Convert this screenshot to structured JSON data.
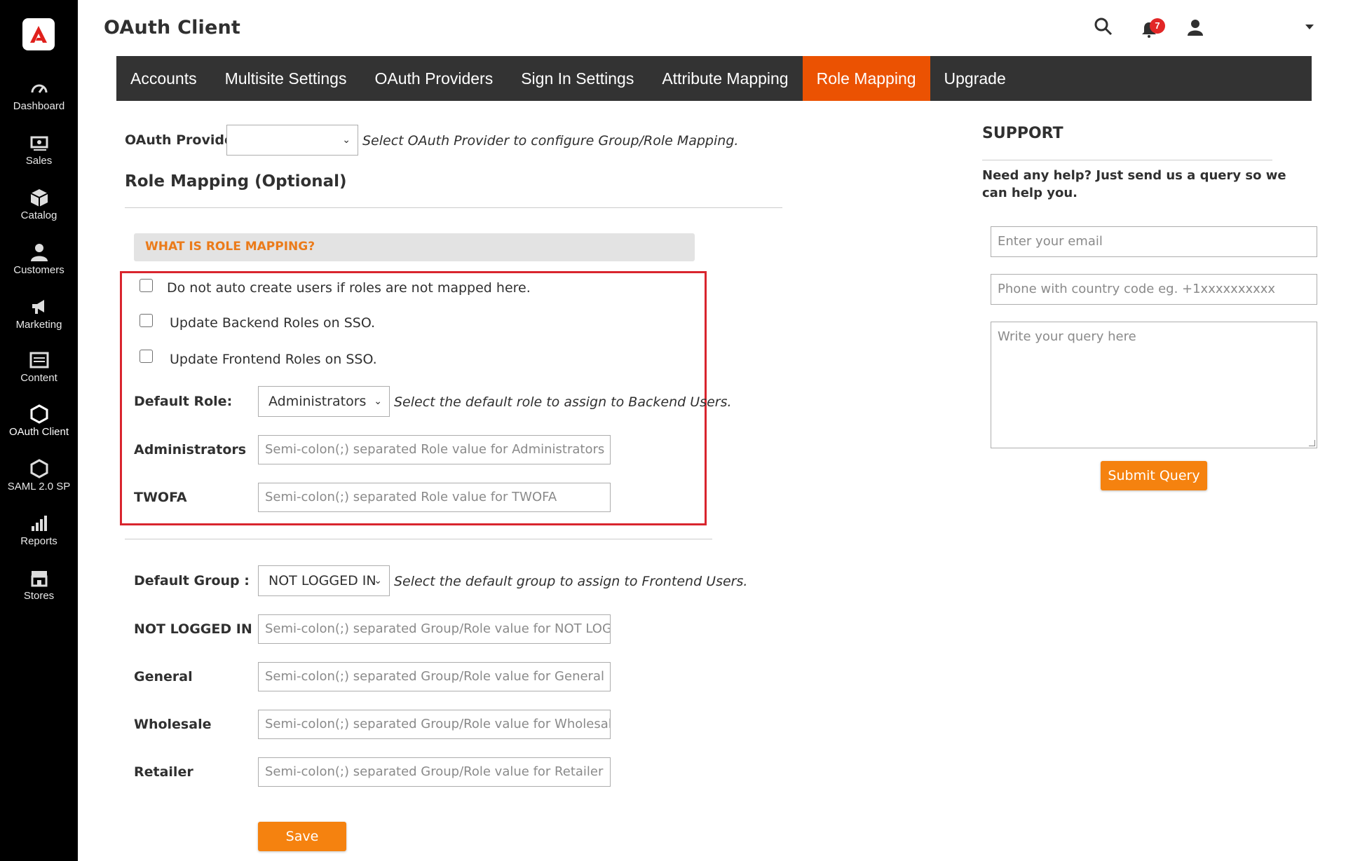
{
  "sidebar": {
    "logo": "adobe-logo",
    "items": [
      {
        "label": "Dashboard",
        "icon": "dashboard-icon"
      },
      {
        "label": "Sales",
        "icon": "sales-icon"
      },
      {
        "label": "Catalog",
        "icon": "catalog-icon"
      },
      {
        "label": "Customers",
        "icon": "customers-icon"
      },
      {
        "label": "Marketing",
        "icon": "marketing-icon"
      },
      {
        "label": "Content",
        "icon": "content-icon"
      },
      {
        "label": "OAuth Client",
        "icon": "hexagon-icon"
      },
      {
        "label": "SAML 2.0 SP",
        "icon": "hexagon-icon"
      },
      {
        "label": "Reports",
        "icon": "reports-icon"
      },
      {
        "label": "Stores",
        "icon": "stores-icon"
      }
    ]
  },
  "header": {
    "title": "OAuth Client",
    "notification_count": "7"
  },
  "tabs": [
    {
      "label": "Accounts"
    },
    {
      "label": "Multisite Settings"
    },
    {
      "label": "OAuth Providers"
    },
    {
      "label": "Sign In Settings"
    },
    {
      "label": "Attribute Mapping"
    },
    {
      "label": "Role Mapping"
    },
    {
      "label": "Upgrade"
    }
  ],
  "form": {
    "provider_label": "OAuth Provider:",
    "provider_value": "",
    "provider_hint": "Select OAuth Provider to configure Group/Role Mapping.",
    "section_title": "Role Mapping (Optional)",
    "what_is": "WHAT IS ROLE MAPPING?",
    "checkboxes": [
      {
        "label": "Do not auto create users if roles are not mapped here.",
        "checked": false
      },
      {
        "label": "Update Backend Roles on SSO.",
        "checked": false
      },
      {
        "label": "Update Frontend Roles on SSO.",
        "checked": false
      }
    ],
    "default_role_label": "Default Role:",
    "default_role_value": "Administrators",
    "default_role_hint": "Select the default role to assign to Backend Users.",
    "roles": [
      {
        "label": "Administrators",
        "placeholder": "Semi-colon(;) separated Role value for Administrators"
      },
      {
        "label": "TWOFA",
        "placeholder": "Semi-colon(;) separated Role value for TWOFA"
      }
    ],
    "default_group_label": "Default Group :",
    "default_group_value": "NOT LOGGED IN",
    "default_group_hint": "Select the default group to assign to Frontend Users.",
    "groups": [
      {
        "label": "NOT LOGGED IN",
        "placeholder": "Semi-colon(;) separated Group/Role value for NOT LOGGED"
      },
      {
        "label": "General",
        "placeholder": "Semi-colon(;) separated Group/Role value for General"
      },
      {
        "label": "Wholesale",
        "placeholder": "Semi-colon(;) separated Group/Role value for Wholesale"
      },
      {
        "label": "Retailer",
        "placeholder": "Semi-colon(;) separated Group/Role value for Retailer"
      }
    ],
    "save_label": "Save"
  },
  "support": {
    "title": "SUPPORT",
    "help_text": "Need any help? Just send us a query so we can help you.",
    "email_placeholder": "Enter your email",
    "phone_placeholder": "Phone with country code eg. +1xxxxxxxxxx",
    "query_placeholder": "Write your query here",
    "submit_label": "Submit Query"
  },
  "colors": {
    "accent": "#eb5202",
    "button": "#f5820f",
    "highlight_border": "#d9252e",
    "tabbar": "#333333",
    "sidebar": "#000000"
  }
}
